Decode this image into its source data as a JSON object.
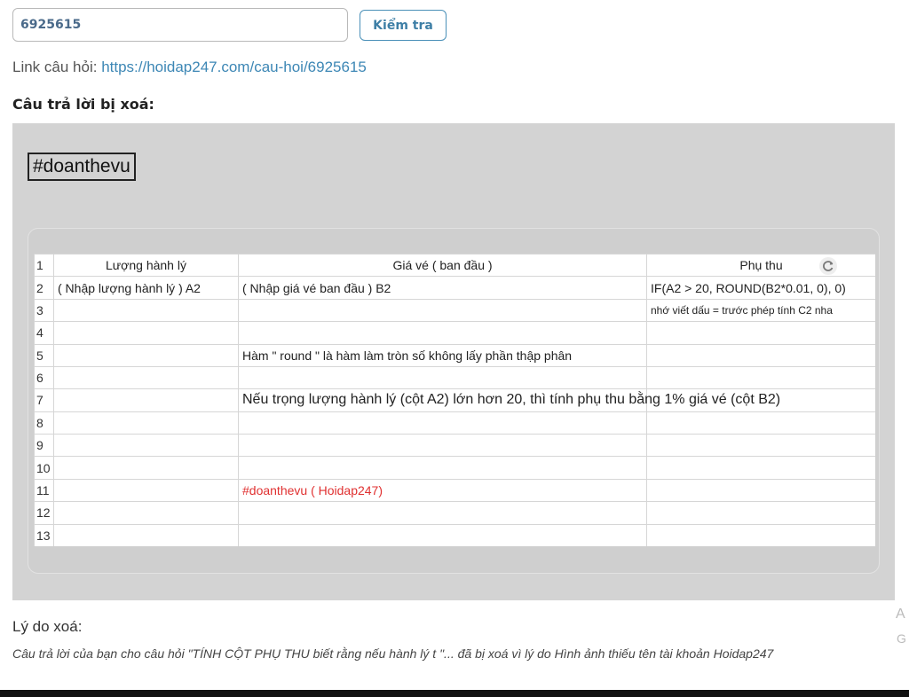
{
  "search": {
    "value": "6925615"
  },
  "check_button": {
    "label": "Kiểm tra"
  },
  "link": {
    "label": "Link câu hỏi: ",
    "url_text": "https://hoidap247.com/cau-hoi/6925615"
  },
  "deleted_heading": "Câu trả lời bị xoá:",
  "answer": {
    "hashtag": "#doanthevu",
    "sheet": {
      "headers": [
        "Lượng hành lý",
        "Giá vé ( ban đầu )",
        "Phụ thu"
      ],
      "rows": [
        [
          "1",
          "Lượng hành lý",
          "Giá vé ( ban đầu )",
          "Phụ thu"
        ],
        [
          "2",
          "( Nhập lượng hành lý ) A2",
          "( Nhập giá vé ban đầu ) B2",
          "IF(A2 > 20, ROUND(B2*0.01, 0), 0)"
        ],
        [
          "3",
          "",
          "",
          "nhớ viết dấu = trước phép tính C2 nha"
        ],
        [
          "4",
          "",
          "",
          ""
        ],
        [
          "5",
          "",
          "Hàm \" round \" là hàm làm tròn số không lấy phần thập phân",
          ""
        ],
        [
          "6",
          "",
          "",
          ""
        ],
        [
          "7",
          "",
          "Nếu trọng lượng hành lý (cột A2) lớn hơn 20, thì tính phụ thu bằng 1% giá vé (cột B2)",
          ""
        ],
        [
          "8",
          "",
          "",
          ""
        ],
        [
          "9",
          "",
          "",
          ""
        ],
        [
          "10",
          "",
          "",
          ""
        ],
        [
          "11",
          "",
          "#doanthevu ( Hoidap247)",
          ""
        ],
        [
          "12",
          "",
          "",
          ""
        ],
        [
          "13",
          "",
          "",
          ""
        ]
      ]
    }
  },
  "reason": {
    "title": "Lý do xoá:",
    "text": "Câu trả lời của bạn cho câu hỏi \"TÍNH CỘT PHỤ THU biết rằng nếu hành lý t \"... đã bị xoá vì lý do Hình ảnh thiếu tên tài khoản Hoidap247"
  },
  "side": {
    "letter1": "A",
    "letter2": "G"
  },
  "colors": {
    "link": "#3d87b5",
    "accent_red": "#e03030",
    "box_gray": "#d3d3d3"
  },
  "icons": {
    "refresh": "refresh-icon"
  }
}
